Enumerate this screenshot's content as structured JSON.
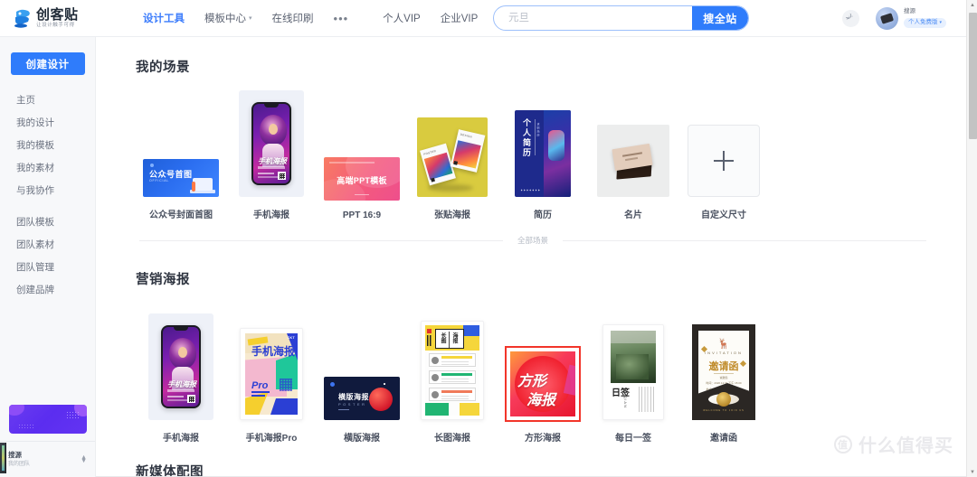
{
  "header": {
    "logo_name": "创客贴",
    "logo_slogan": "让设计触手可得",
    "nav": [
      {
        "label": "设计工具",
        "active": true,
        "caret": ""
      },
      {
        "label": "模板中心",
        "active": false,
        "caret": "▾"
      },
      {
        "label": "在线印刷",
        "active": false,
        "caret": ""
      },
      {
        "label": "•••",
        "active": false,
        "caret": ""
      },
      {
        "label": "个人VIP",
        "active": false,
        "caret": ""
      },
      {
        "label": "企业VIP",
        "active": false,
        "caret": ""
      }
    ],
    "search": {
      "placeholder": "元旦",
      "value": "",
      "button_label": "搜全站"
    },
    "message_icon": "chat-bubble-icon",
    "user": {
      "name": "搜源",
      "badge_label": "个人免费版",
      "badge_caret": "▾"
    }
  },
  "sidebar": {
    "create_button": "创建设计",
    "items_primary": [
      {
        "label": "主页"
      },
      {
        "label": "我的设计"
      },
      {
        "label": "我的模板"
      },
      {
        "label": "我的素材"
      },
      {
        "label": "与我协作"
      }
    ],
    "items_team": [
      {
        "label": "团队模板"
      },
      {
        "label": "团队素材"
      },
      {
        "label": "团队管理"
      },
      {
        "label": "创建品牌"
      }
    ],
    "team_selector": {
      "name": "搜源",
      "subtitle": "我的团队"
    }
  },
  "main": {
    "sections": [
      {
        "title": "我的场景",
        "cards": [
          {
            "label": "公众号封面首图",
            "art": "wx"
          },
          {
            "label": "手机海报",
            "art": "phone"
          },
          {
            "label": "PPT 16:9",
            "art": "ppt"
          },
          {
            "label": "张贴海报",
            "art": "poster"
          },
          {
            "label": "简历",
            "art": "cv"
          },
          {
            "label": "名片",
            "art": "card"
          },
          {
            "label": "自定义尺寸",
            "art": "plus"
          }
        ],
        "footer_link": "全部场景"
      },
      {
        "title": "营销海报",
        "cards": [
          {
            "label": "手机海报",
            "art": "phone2"
          },
          {
            "label": "手机海报Pro",
            "art": "pro"
          },
          {
            "label": "横版海报",
            "art": "land"
          },
          {
            "label": "长图海报",
            "art": "long"
          },
          {
            "label": "方形海报",
            "art": "square"
          },
          {
            "label": "每日一签",
            "art": "day"
          },
          {
            "label": "邀请函",
            "art": "invite"
          }
        ]
      },
      {
        "title": "新媒体配图",
        "cards": []
      }
    ]
  },
  "thumb_text": {
    "wx_title": "公众号首图",
    "wx_sub": "OFFICIAL",
    "ppt_title": "高端PPT模板",
    "cv_title": "个人简历",
    "cv_sub": "求职简历",
    "phone_title": "手机海报",
    "pro_title": "手机海报",
    "pro_sub": "Pro",
    "pro_tag": "CKT",
    "land_title": "横版海报",
    "land_sub": "POSTER",
    "long_a": "长图",
    "long_b": "海报",
    "square_t1": "方形",
    "square_t2": "海报",
    "day_title": "日签",
    "day_en": "RI QIAN",
    "invite_en": "INVITATION",
    "invite_title": "邀请函",
    "invite_s1": "诚邀您",
    "invite_s2": "时间：2020.12.31  下午 15:00",
    "invite_s3": "地点：北京市朝阳区设计大厦",
    "invite_bt": "WELCOME TO JOIN US",
    "plus_icon": "plus-icon"
  },
  "scrollbar": {
    "up_arrow": "▲",
    "down_arrow": "▼"
  },
  "watermark": {
    "mark": "值",
    "text": "什么值得买"
  },
  "colors": {
    "accent": "#2f7cfb",
    "accent_light": "#e7f0fe",
    "sidebar_bg": "#f7f8fa",
    "text_primary": "#2e3440",
    "text_muted": "#6b7280"
  }
}
